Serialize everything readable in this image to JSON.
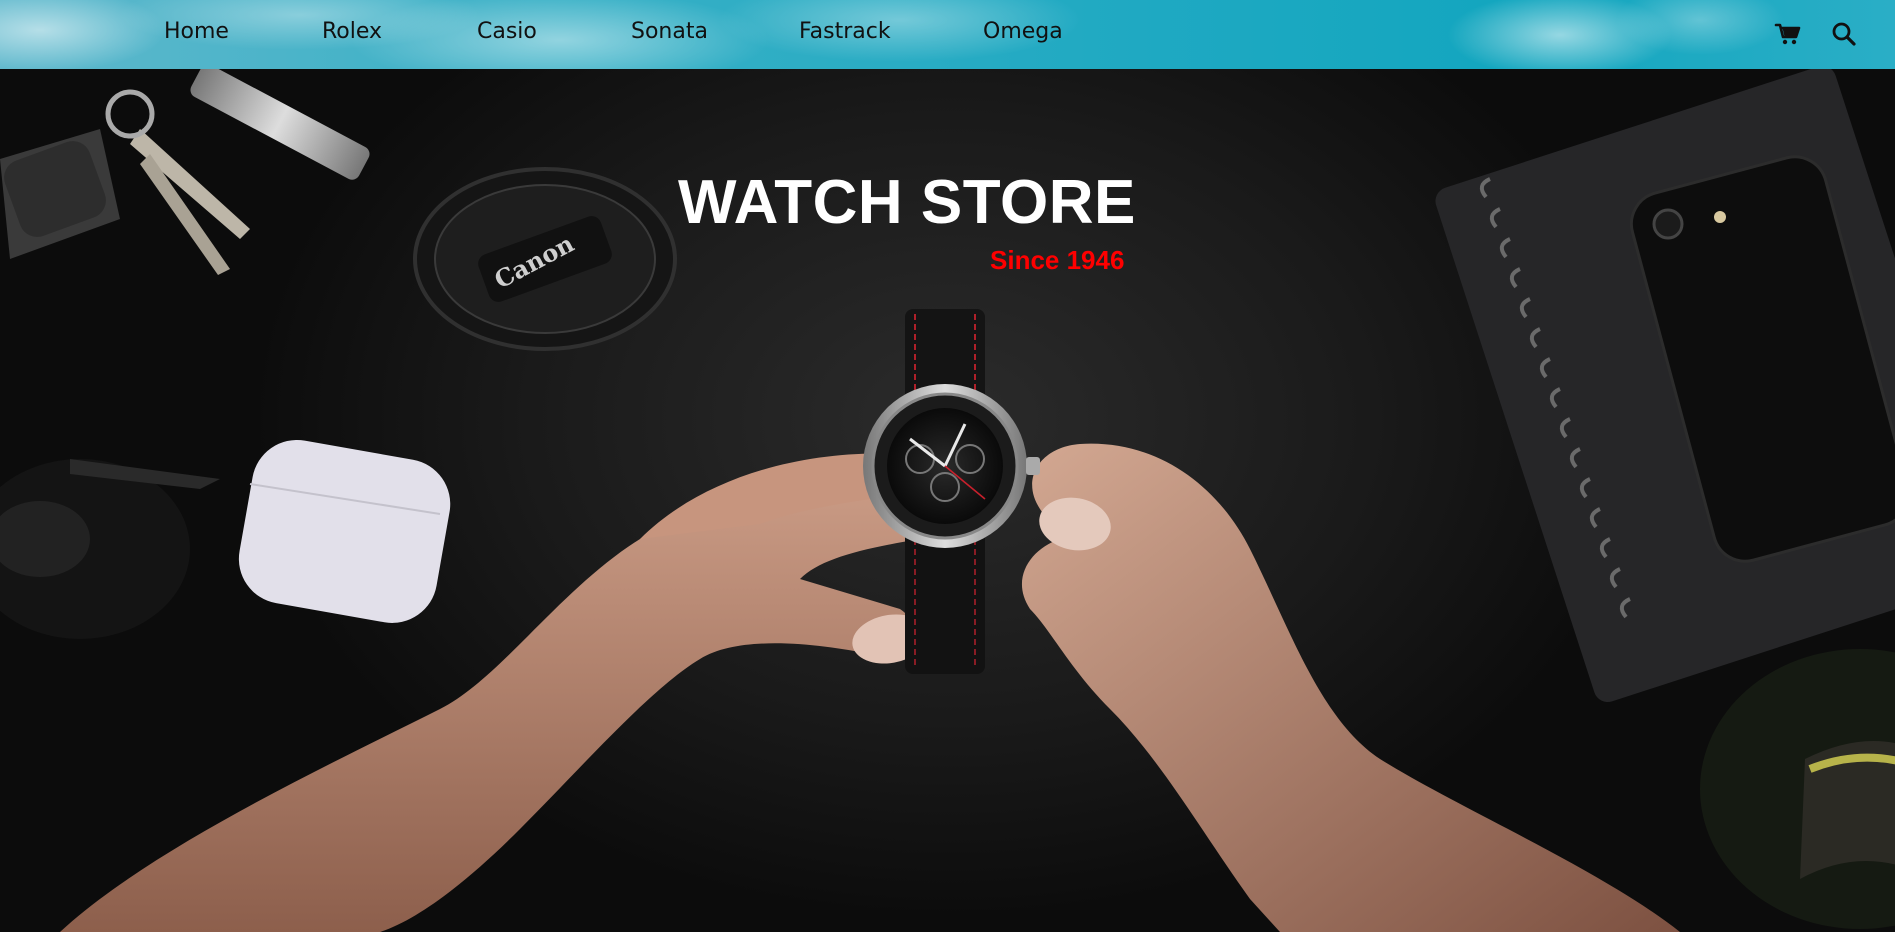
{
  "nav": {
    "links": [
      {
        "label": "Home"
      },
      {
        "label": "Rolex"
      },
      {
        "label": "Casio"
      },
      {
        "label": "Sonata"
      },
      {
        "label": "Fastrack"
      },
      {
        "label": "Omega"
      }
    ],
    "icons": {
      "cart": "cart-icon",
      "search": "search-icon"
    },
    "colors": {
      "bar": "#1fa9c2",
      "text": "#111111"
    }
  },
  "hero": {
    "title": "WATCH STORE",
    "tagline": "Since 1946",
    "lens_cap_brand": "Canon",
    "colors": {
      "title": "#ffffff",
      "tagline": "#ff0000",
      "background": "#1a1a1a"
    }
  }
}
